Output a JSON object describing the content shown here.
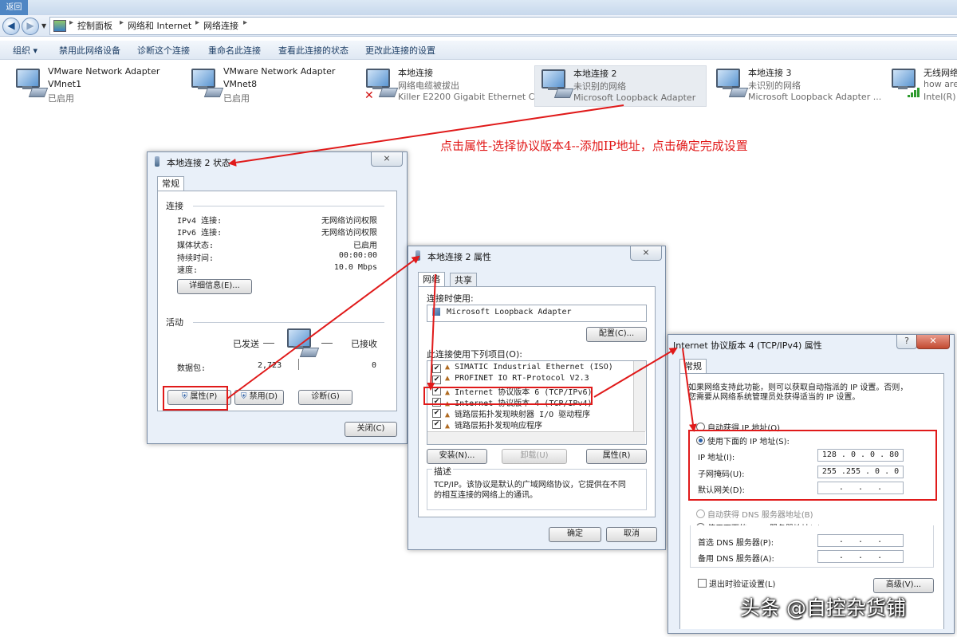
{
  "taskbar": {
    "label": "返回"
  },
  "breadcrumb": {
    "items": [
      "控制面板",
      "网络和 Internet",
      "网络连接"
    ]
  },
  "toolbar": {
    "items": [
      "组织 ▾",
      "禁用此网络设备",
      "诊断这个连接",
      "重命名此连接",
      "查看此连接的状态",
      "更改此连接的设置"
    ]
  },
  "adapters": [
    {
      "name": "VMware Network Adapter",
      "line2": "VMnet1",
      "line3": "已启用"
    },
    {
      "name": "VMware Network Adapter",
      "line2": "VMnet8",
      "line3": "已启用"
    },
    {
      "name": "本地连接",
      "line2": "网络电缆被拔出",
      "line3": "Killer E2200 Gigabit Ethernet C..."
    },
    {
      "name": "本地连接 2",
      "line2": "未识别的网络",
      "line3": "Microsoft Loopback Adapter"
    },
    {
      "name": "本地连接 3",
      "line2": "未识别的网络",
      "line3": "Microsoft Loopback Adapter ..."
    },
    {
      "name": "无线网络",
      "line2": "how are",
      "line3": "Intel(R) C"
    }
  ],
  "annotation": {
    "text": "点击属性-选择协议版本4--添加IP地址，点击确定完成设置"
  },
  "status_dialog": {
    "title": "本地连接 2 状态",
    "close_glyph": "⨯",
    "tab": "常规",
    "section_connection": "连接",
    "rows": [
      {
        "label": "IPv4 连接:",
        "value": "无网络访问权限"
      },
      {
        "label": "IPv6 连接:",
        "value": "无网络访问权限"
      },
      {
        "label": "媒体状态:",
        "value": "已启用"
      },
      {
        "label": "持续时间:",
        "value": "00:00:00"
      },
      {
        "label": "速度:",
        "value": "10.0 Mbps"
      }
    ],
    "details_button": "详细信息(E)...",
    "section_activity": "活动",
    "sent_label": "已发送",
    "received_label": "已接收",
    "packets_label": "数据包:",
    "packets_sent": "2,723",
    "packets_received": "0",
    "properties_button": "属性(P)",
    "disable_button": "禁用(D)",
    "diagnose_button": "诊断(G)",
    "close_button": "关闭(C)"
  },
  "props_dialog": {
    "title": "本地连接 2 属性",
    "close_glyph": "⨯",
    "tab_network": "网络",
    "tab_sharing": "共享",
    "connect_using_label": "连接时使用:",
    "adapter_name": "Microsoft Loopback Adapter",
    "configure_button": "配置(C)...",
    "items_label": "此连接使用下列项目(O):",
    "items": [
      "SIMATIC Industrial Ethernet (ISO)",
      "PROFINET IO RT-Protocol V2.3",
      "Internet 协议版本 6 (TCP/IPv6)",
      "Internet 协议版本 4 (TCP/IPv4)",
      "链路层拓扑发现映射器 I/O 驱动程序",
      "链路层拓扑发现响应程序"
    ],
    "install_button": "安装(N)...",
    "uninstall_button": "卸载(U)",
    "properties_button": "属性(R)",
    "description_label": "描述",
    "description_text_1": "TCP/IP。该协议是默认的广域网络协议，它提供在不同",
    "description_text_2": "的相互连接的网络上的通讯。",
    "ok_button": "确定",
    "cancel_button": "取消"
  },
  "ipv4_dialog": {
    "title": "Internet 协议版本 4 (TCP/IPv4) 属性",
    "help_glyph": "?",
    "close_glyph": "✕",
    "tab": "常规",
    "intro_1": "如果网络支持此功能，则可以获取自动指派的 IP 设置。否则，",
    "intro_2": "您需要从网络系统管理员处获得适当的 IP 设置。",
    "auto_ip": "自动获得 IP 地址(O)",
    "manual_ip": "使用下面的 IP 地址(S):",
    "ip_label": "IP 地址(I):",
    "ip_value": "128 . 0 . 0 . 80",
    "mask_label": "子网掩码(U):",
    "mask_value": "255 .255 . 0 . 0",
    "gateway_label": "默认网关(D):",
    "gateway_value": ".   .   .",
    "auto_dns": "自动获得 DNS 服务器地址(B)",
    "manual_dns": "使用下面的 DNS 服务器地址(E):",
    "pref_dns_label": "首选 DNS 服务器(P):",
    "pref_dns_value": ".   .   .",
    "alt_dns_label": "备用 DNS 服务器(A):",
    "alt_dns_value": ".   .   .",
    "validate_label": "退出时验证设置(L)",
    "advanced_button": "高级(V)..."
  },
  "watermark": {
    "text": "头条 @自控杂货铺"
  }
}
